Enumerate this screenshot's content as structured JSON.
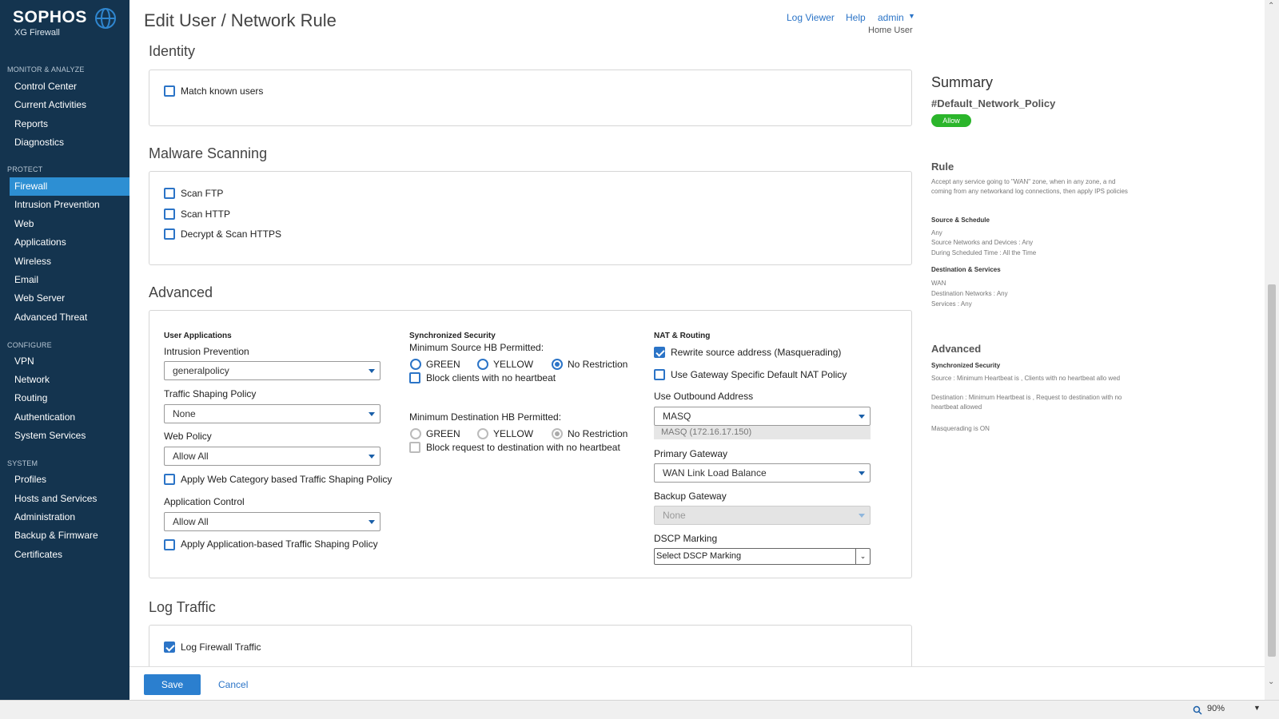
{
  "brand": {
    "name": "SOPHOS",
    "product": "XG Firewall"
  },
  "header": {
    "title": "Edit User / Network Rule",
    "log_viewer": "Log Viewer",
    "help": "Help",
    "admin": "admin",
    "role": "Home User"
  },
  "sidebar": {
    "sections": [
      {
        "label": "MONITOR & ANALYZE",
        "items": [
          "Control Center",
          "Current Activities",
          "Reports",
          "Diagnostics"
        ]
      },
      {
        "label": "PROTECT",
        "items": [
          "Firewall",
          "Intrusion Prevention",
          "Web",
          "Applications",
          "Wireless",
          "Email",
          "Web Server",
          "Advanced Threat"
        ]
      },
      {
        "label": "CONFIGURE",
        "items": [
          "VPN",
          "Network",
          "Routing",
          "Authentication",
          "System Services"
        ]
      },
      {
        "label": "SYSTEM",
        "items": [
          "Profiles",
          "Hosts and Services",
          "Administration",
          "Backup & Firmware",
          "Certificates"
        ]
      }
    ],
    "active_item": "Firewall"
  },
  "identity": {
    "title": "Identity",
    "match_known_users": "Match known users",
    "match_known_users_checked": false
  },
  "malware": {
    "title": "Malware Scanning",
    "scan_ftp": "Scan FTP",
    "scan_http": "Scan HTTP",
    "decrypt_https": "Decrypt & Scan HTTPS"
  },
  "advanced": {
    "title": "Advanced",
    "user_apps": {
      "heading": "User Applications",
      "ips_label": "Intrusion Prevention",
      "ips_value": "generalpolicy",
      "traffic_label": "Traffic Shaping Policy",
      "traffic_value": "None",
      "web_label": "Web Policy",
      "web_value": "Allow All",
      "web_cat_shaping": "Apply Web Category based Traffic Shaping Policy",
      "app_control_label": "Application Control",
      "app_control_value": "Allow All",
      "app_shaping": "Apply Application-based Traffic Shaping Policy"
    },
    "sync_sec": {
      "heading": "Synchronized Security",
      "min_source_label": "Minimum Source HB Permitted:",
      "green": "GREEN",
      "yellow": "YELLOW",
      "no_restriction": "No Restriction",
      "source_selected": "No Restriction",
      "block_clients": "Block clients with no heartbeat",
      "min_dest_label": "Minimum Destination HB Permitted:",
      "dest_selected": "No Restriction",
      "block_dest": "Block request to destination with no heartbeat"
    },
    "nat": {
      "heading": "NAT & Routing",
      "rewrite_source": "Rewrite source address (Masquerading)",
      "rewrite_checked": true,
      "gateway_nat": "Use Gateway Specific Default NAT Policy",
      "outbound_label": "Use Outbound Address",
      "outbound_value": "MASQ",
      "outbound_detail": "MASQ (172.16.17.150)",
      "primary_gw_label": "Primary Gateway",
      "primary_gw_value": "WAN Link Load Balance",
      "backup_gw_label": "Backup Gateway",
      "backup_gw_value": "None",
      "dscp_label": "DSCP Marking",
      "dscp_value": "Select DSCP Marking"
    }
  },
  "log_traffic": {
    "title": "Log Traffic",
    "log_firewall": "Log Firewall Traffic",
    "log_checked": true
  },
  "footer": {
    "save": "Save",
    "cancel": "Cancel"
  },
  "summary": {
    "title": "Summary",
    "rule_name": "#Default_Network_Policy",
    "action_badge": "Allow",
    "rule_heading": "Rule",
    "rule_desc": "Accept any service going to \"WAN\" zone, when in any zone, a nd coming from any networkand log connections, then apply IPS policies",
    "source_heading": "Source & Schedule",
    "source_lines": [
      "Any",
      "Source Networks and Devices : Any",
      "During Scheduled Time : All the Time"
    ],
    "dest_heading": "Destination & Services",
    "dest_lines": [
      "WAN",
      "Destination Networks : Any",
      "Services : Any"
    ],
    "advanced_heading": "Advanced",
    "sync_heading": "Synchronized Security",
    "sync_source": "Source : Minimum Heartbeat is , Clients with no heartbeat allo wed",
    "sync_dest": "Destination : Minimum Heartbeat is , Request to destination with no heartbeat allowed",
    "masq": "Masquerading is ON"
  },
  "statusbar": {
    "zoom": "90%"
  },
  "colors": {
    "sidebar": "#14344f",
    "accent": "#2b74c7",
    "active_nav": "#2d8fd3",
    "allow_badge": "#2bb52b"
  }
}
